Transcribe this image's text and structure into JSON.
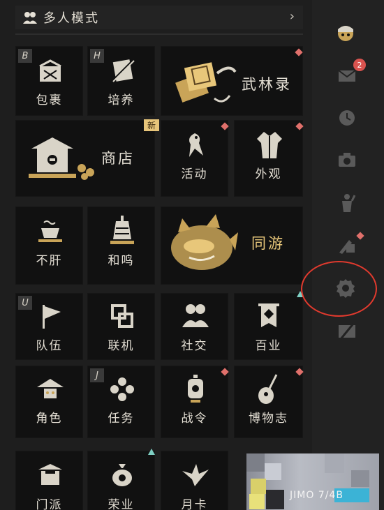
{
  "header": {
    "title": "多人模式",
    "chevron": "›"
  },
  "row1": {
    "bag": {
      "key": "B",
      "label": "包裹"
    },
    "train": {
      "key": "H",
      "label": "培养"
    },
    "wulin": {
      "label": "武林录"
    }
  },
  "row2": {
    "shop": {
      "label": "商店",
      "badge": "新"
    },
    "event": {
      "label": "活动"
    },
    "appearance": {
      "label": "外观"
    }
  },
  "row3": {
    "buGan": {
      "label": "不肝"
    },
    "heMing": {
      "label": "和鸣"
    },
    "tongYou": {
      "label": "同游"
    }
  },
  "row4": {
    "team": {
      "key": "U",
      "label": "队伍"
    },
    "online": {
      "label": "联机"
    },
    "social": {
      "label": "社交"
    },
    "baiye": {
      "label": "百业"
    }
  },
  "row5": {
    "role": {
      "label": "角色"
    },
    "quest": {
      "key": "J",
      "label": "任务"
    },
    "battlepass": {
      "label": "战令"
    },
    "museum": {
      "label": "博物志"
    }
  },
  "row6": {
    "tile1": {
      "label": "门派"
    },
    "tile2": {
      "label": "荣业"
    },
    "tile3": {
      "label": "月卡"
    }
  },
  "sidebar": {
    "mail_count": "2"
  },
  "watermark": {
    "text": "JIMO 7/4B"
  },
  "colors": {
    "accent_gold": "#e8c77a",
    "dot_red": "#e0706b",
    "tri_teal": "#7fd0c4",
    "circle_red": "#e23a2e"
  }
}
